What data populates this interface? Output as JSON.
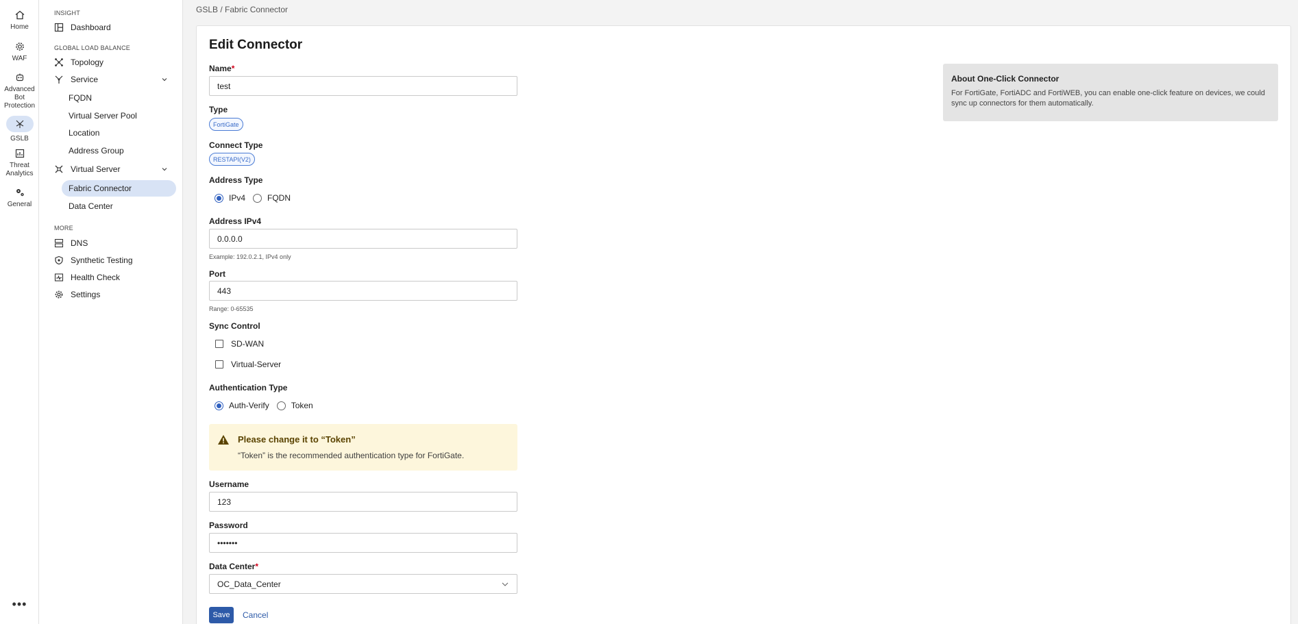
{
  "rail": {
    "items": [
      {
        "label": "Home",
        "icon": "home-icon"
      },
      {
        "label": "WAF",
        "icon": "gear-icon"
      },
      {
        "label": "Advanced Bot Protection",
        "icon": "bot-icon"
      },
      {
        "label": "GSLB",
        "icon": "gslb-icon"
      },
      {
        "label": "Threat Analytics",
        "icon": "chart-icon"
      },
      {
        "label": "General",
        "icon": "gears-icon"
      }
    ],
    "more": "•••"
  },
  "nav": {
    "sections": {
      "insight": "INSIGHT",
      "gslb": "GLOBAL LOAD BALANCE",
      "more": "MORE"
    },
    "items": {
      "dashboard": "Dashboard",
      "topology": "Topology",
      "service": "Service",
      "fqdn": "FQDN",
      "virtual_server_pool": "Virtual Server Pool",
      "location": "Location",
      "address_group": "Address Group",
      "virtual_server": "Virtual Server",
      "fabric_connector": "Fabric Connector",
      "data_center": "Data Center",
      "dns": "DNS",
      "synthetic_testing": "Synthetic Testing",
      "health_check": "Health Check",
      "settings": "Settings"
    }
  },
  "breadcrumb": "GSLB / Fabric Connector",
  "form": {
    "title": "Edit Connector",
    "name": {
      "label": "Name",
      "required": "*",
      "value": "test"
    },
    "type": {
      "label": "Type",
      "value": "FortiGate"
    },
    "connect_type": {
      "label": "Connect Type",
      "value": "RESTAPI(V2)"
    },
    "address_type": {
      "label": "Address Type",
      "options": [
        "IPv4",
        "FQDN"
      ],
      "selected": "IPv4"
    },
    "address_ipv4": {
      "label": "Address IPv4",
      "value": "0.0.0.0",
      "hint": "Example: 192.0.2.1, IPv4 only"
    },
    "port": {
      "label": "Port",
      "value": "443",
      "hint": "Range: 0-65535"
    },
    "sync_control": {
      "label": "Sync Control",
      "options": [
        "SD-WAN",
        "Virtual-Server"
      ]
    },
    "auth_type": {
      "label": "Authentication Type",
      "options": [
        "Auth-Verify",
        "Token"
      ],
      "selected": "Auth-Verify"
    },
    "warning": {
      "title": "Please change it to “Token”",
      "text": "“Token” is the recommended authentication type for FortiGate."
    },
    "username": {
      "label": "Username",
      "value": "123"
    },
    "password": {
      "label": "Password",
      "value": "•••••••"
    },
    "data_center": {
      "label": "Data Center",
      "required": "*",
      "value": "OC_Data_Center"
    },
    "save": "Save",
    "cancel": "Cancel"
  },
  "about": {
    "title": "About One-Click Connector",
    "text": "For FortiGate, FortiADC and FortiWEB, you can enable one-click feature on devices, we could sync up connectors for them automatically."
  },
  "colors": {
    "accent": "#2d5aa8",
    "active_bg": "#d8e3f5",
    "warning_bg": "#fdf6dc"
  }
}
